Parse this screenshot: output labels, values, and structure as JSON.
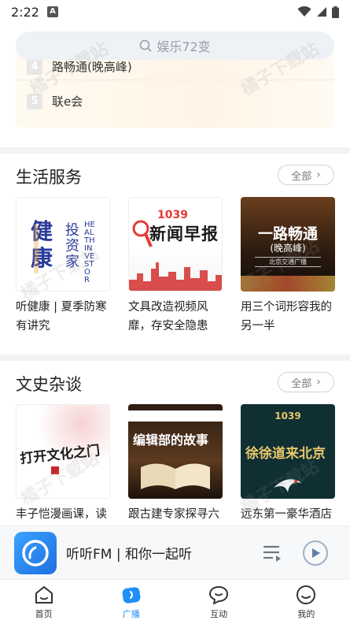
{
  "status": {
    "time": "2:22",
    "app_badge": "A"
  },
  "search": {
    "placeholder": "娱乐72变"
  },
  "top_list": {
    "items": [
      {
        "rank": "4",
        "label": "路畅通(晚高峰)"
      },
      {
        "rank": "5",
        "label": "联e会"
      }
    ]
  },
  "sections": [
    {
      "title": "生活服务",
      "more": "全部",
      "cards": [
        {
          "cover_title": "健康",
          "cover_sub": "投资家",
          "cover_en": "HEALTH INVESTOR",
          "caption": "听健康 | 夏季防寒有讲究"
        },
        {
          "cover_title": "新闻早报",
          "cover_sub": "1039",
          "caption": "文具改造视频风靡，存安全隐患"
        },
        {
          "cover_title": "一路畅通",
          "cover_sub": "(晚高峰)",
          "cover_tag": "北京交通广播",
          "caption": "用三个词形容我的另一半"
        }
      ]
    },
    {
      "title": "文史杂谈",
      "more": "全部",
      "cards": [
        {
          "cover_title": "打开文化之门",
          "caption": "丰子恺漫画课，读"
        },
        {
          "cover_title": "编辑部的故事",
          "caption": "跟古建专家探寻六"
        },
        {
          "cover_title": "徐徐道来北京",
          "cover_sub": "1039",
          "caption": "远东第一豪华酒店"
        }
      ]
    }
  ],
  "player": {
    "title": "听听FM | 和你一起听"
  },
  "tabs": [
    {
      "label": "首页",
      "icon": "home-icon"
    },
    {
      "label": "广播",
      "icon": "broadcast-icon"
    },
    {
      "label": "互动",
      "icon": "chat-icon"
    },
    {
      "label": "我的",
      "icon": "profile-icon"
    }
  ],
  "watermark": "橘子下载站",
  "colors": {
    "accent": "#1f8ff5",
    "text": "#222222",
    "section_gap": "#f2f3f5"
  }
}
